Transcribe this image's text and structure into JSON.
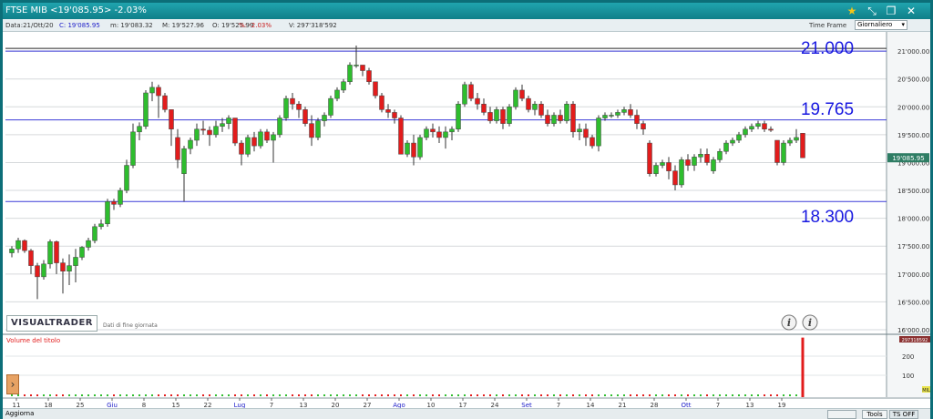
{
  "window": {
    "title": "FTSE MIB <19'085.95> -2.03%",
    "star_icon": "star-icon",
    "collapse_icon": "arrow-diagonal-icon",
    "restore_icon": "restore-icon",
    "close_icon": "close-icon"
  },
  "info": {
    "data": "Data:21/Ott/20",
    "close": "C: 19'085.95",
    "min": "m: 19'083.32",
    "max": "M: 19'527.96",
    "open": "O: 19'525.99",
    "pct": "%: -2.03%",
    "volume": "V: 297'318'592",
    "timeframe_label": "Time Frame",
    "timeframe_value": "Giornaliero"
  },
  "chart_data": {
    "type": "candlestick",
    "ylim": [
      16000,
      21100
    ],
    "y_ticks": [
      "21'000.00",
      "20'500.00",
      "20'000.00",
      "19'500.00",
      "19'000.00",
      "18'500.00",
      "18'000.00",
      "17'500.00",
      "17'000.00",
      "16'500.00",
      "16'000.00"
    ],
    "y_tick_values": [
      21000,
      20500,
      20000,
      19500,
      19000,
      18500,
      18000,
      17500,
      17000,
      16500,
      16000
    ],
    "x_labels": [
      "11",
      "18",
      "25",
      "Giu",
      "8",
      "15",
      "22",
      "Lug",
      "7",
      "13",
      "20",
      "27",
      "Ago",
      "10",
      "17",
      "24",
      "Set",
      "7",
      "14",
      "21",
      "28",
      "Ott",
      "7",
      "13",
      "19"
    ],
    "x_label_index": [
      0,
      5,
      10,
      15,
      20,
      25,
      30,
      35,
      40,
      45,
      50,
      55,
      60,
      65,
      70,
      75,
      80,
      85,
      90,
      95,
      100,
      105,
      110,
      115,
      120
    ],
    "x_label_is_month": [
      false,
      false,
      false,
      true,
      false,
      false,
      false,
      true,
      false,
      false,
      false,
      false,
      true,
      false,
      false,
      false,
      true,
      false,
      false,
      false,
      false,
      true,
      false,
      false,
      false
    ],
    "levels": [
      {
        "value": 21000,
        "label": "21.000"
      },
      {
        "value": 19765,
        "label": "19.765"
      },
      {
        "value": 18300,
        "label": "18.300"
      }
    ],
    "last_price_label": "19'085.95",
    "last_price": 19085.95,
    "candles": [
      [
        17380,
        17500,
        17300,
        17450
      ],
      [
        17450,
        17650,
        17380,
        17600
      ],
      [
        17600,
        17620,
        17380,
        17420
      ],
      [
        17420,
        17450,
        17000,
        17150
      ],
      [
        17150,
        17200,
        16550,
        16950
      ],
      [
        16950,
        17250,
        16900,
        17180
      ],
      [
        17180,
        17620,
        17100,
        17580
      ],
      [
        17580,
        17600,
        17000,
        17200
      ],
      [
        17200,
        17280,
        16650,
        17050
      ],
      [
        17050,
        17350,
        16800,
        17150
      ],
      [
        17150,
        17450,
        16850,
        17300
      ],
      [
        17300,
        17500,
        17250,
        17480
      ],
      [
        17480,
        17650,
        17420,
        17600
      ],
      [
        17600,
        17900,
        17550,
        17850
      ],
      [
        17850,
        17980,
        17800,
        17900
      ],
      [
        17900,
        18350,
        17850,
        18300
      ],
      [
        18300,
        18350,
        18150,
        18250
      ],
      [
        18250,
        18550,
        18200,
        18500
      ],
      [
        18500,
        19050,
        18450,
        18950
      ],
      [
        18950,
        19700,
        18900,
        19550
      ],
      [
        19550,
        19720,
        19400,
        19650
      ],
      [
        19650,
        20300,
        19600,
        20250
      ],
      [
        20250,
        20450,
        20100,
        20350
      ],
      [
        20350,
        20400,
        19800,
        20200
      ],
      [
        20200,
        20250,
        19900,
        19950
      ],
      [
        19950,
        19950,
        19300,
        19600
      ],
      [
        19450,
        19600,
        18900,
        19050
      ],
      [
        18800,
        19300,
        18300,
        19250
      ],
      [
        19250,
        19450,
        19150,
        19400
      ],
      [
        19400,
        19700,
        19300,
        19600
      ],
      [
        19600,
        19750,
        19500,
        19580
      ],
      [
        19580,
        19650,
        19300,
        19500
      ],
      [
        19500,
        19750,
        19450,
        19650
      ],
      [
        19650,
        19800,
        19550,
        19700
      ],
      [
        19700,
        19850,
        19600,
        19800
      ],
      [
        19800,
        19800,
        19300,
        19350
      ],
      [
        19350,
        19400,
        18950,
        19150
      ],
      [
        19150,
        19500,
        19100,
        19450
      ],
      [
        19450,
        19550,
        19200,
        19300
      ],
      [
        19300,
        19600,
        19250,
        19550
      ],
      [
        19550,
        19600,
        19350,
        19400
      ],
      [
        19400,
        19550,
        19000,
        19500
      ],
      [
        19500,
        19850,
        19450,
        19800
      ],
      [
        19800,
        20200,
        19750,
        20150
      ],
      [
        20150,
        20250,
        19950,
        20050
      ],
      [
        20050,
        20100,
        19800,
        19950
      ],
      [
        19950,
        20000,
        19650,
        19700
      ],
      [
        19700,
        19850,
        19300,
        19450
      ],
      [
        19450,
        19800,
        19400,
        19750
      ],
      [
        19750,
        19900,
        19650,
        19850
      ],
      [
        19850,
        20200,
        19800,
        20150
      ],
      [
        20150,
        20350,
        20100,
        20300
      ],
      [
        20300,
        20500,
        20250,
        20450
      ],
      [
        20450,
        20800,
        20400,
        20750
      ],
      [
        20750,
        21100,
        20700,
        20750
      ],
      [
        20750,
        20700,
        20550,
        20650
      ],
      [
        20650,
        20700,
        20400,
        20450
      ],
      [
        20450,
        20450,
        20150,
        20200
      ],
      [
        20200,
        20250,
        19900,
        19950
      ],
      [
        19950,
        20050,
        19800,
        19900
      ],
      [
        19900,
        19950,
        19700,
        19800
      ],
      [
        19800,
        19850,
        19150,
        19150
      ],
      [
        19150,
        19400,
        19100,
        19350
      ],
      [
        19350,
        19500,
        18950,
        19100
      ],
      [
        19100,
        19500,
        19050,
        19450
      ],
      [
        19450,
        19650,
        19400,
        19600
      ],
      [
        19600,
        19700,
        19450,
        19550
      ],
      [
        19550,
        19650,
        19350,
        19450
      ],
      [
        19450,
        19650,
        19250,
        19550
      ],
      [
        19550,
        19650,
        19400,
        19600
      ],
      [
        19600,
        20100,
        19550,
        20050
      ],
      [
        20050,
        20450,
        20000,
        20400
      ],
      [
        20400,
        20450,
        20100,
        20150
      ],
      [
        20150,
        20250,
        19950,
        20050
      ],
      [
        20050,
        20150,
        19850,
        19900
      ],
      [
        19900,
        20000,
        19700,
        19750
      ],
      [
        19750,
        20000,
        19700,
        19950
      ],
      [
        19950,
        20000,
        19600,
        19700
      ],
      [
        19700,
        20050,
        19650,
        20000
      ],
      [
        20000,
        20350,
        19950,
        20300
      ],
      [
        20300,
        20400,
        20100,
        20150
      ],
      [
        20150,
        20200,
        19900,
        19950
      ],
      [
        19950,
        20100,
        19850,
        20050
      ],
      [
        20050,
        20100,
        19800,
        19850
      ],
      [
        19850,
        19950,
        19650,
        19700
      ],
      [
        19700,
        19900,
        19650,
        19850
      ],
      [
        19850,
        19950,
        19700,
        19750
      ],
      [
        19750,
        20100,
        19700,
        20050
      ],
      [
        20050,
        20100,
        19450,
        19550
      ],
      [
        19550,
        19700,
        19400,
        19600
      ],
      [
        19600,
        19700,
        19300,
        19450
      ],
      [
        19450,
        19500,
        19250,
        19300
      ],
      [
        19300,
        19850,
        19200,
        19800
      ],
      [
        19800,
        19900,
        19750,
        19850
      ],
      [
        19850,
        19900,
        19800,
        19850
      ],
      [
        19850,
        19950,
        19800,
        19900
      ],
      [
        19900,
        20000,
        19850,
        19950
      ],
      [
        19950,
        20050,
        19800,
        19850
      ],
      [
        19850,
        19950,
        19600,
        19700
      ],
      [
        19700,
        19750,
        19500,
        19600
      ],
      [
        19350,
        19400,
        18750,
        18800
      ],
      [
        18800,
        19000,
        18750,
        18950
      ],
      [
        18950,
        19050,
        18900,
        19000
      ],
      [
        19000,
        19100,
        18700,
        18850
      ],
      [
        18850,
        18950,
        18500,
        18600
      ],
      [
        18600,
        19100,
        18550,
        19050
      ],
      [
        19050,
        19150,
        18850,
        18950
      ],
      [
        18950,
        19150,
        18850,
        19100
      ],
      [
        19100,
        19250,
        19000,
        19150
      ],
      [
        19150,
        19250,
        18950,
        19000
      ],
      [
        18850,
        19100,
        18800,
        19050
      ],
      [
        19050,
        19250,
        19000,
        19200
      ],
      [
        19200,
        19400,
        19150,
        19350
      ],
      [
        19350,
        19450,
        19300,
        19400
      ],
      [
        19400,
        19550,
        19350,
        19500
      ],
      [
        19500,
        19650,
        19450,
        19600
      ],
      [
        19600,
        19700,
        19550,
        19650
      ],
      [
        19650,
        19750,
        19600,
        19700
      ],
      [
        19700,
        19750,
        19550,
        19600
      ],
      [
        19600,
        19650,
        19550,
        19580
      ],
      [
        19400,
        19400,
        18950,
        19000
      ],
      [
        19000,
        19400,
        18950,
        19350
      ],
      [
        19350,
        19450,
        19300,
        19400
      ],
      [
        19400,
        19600,
        19350,
        19450
      ],
      [
        19525.99,
        19527.96,
        19083.32,
        19085.95
      ]
    ],
    "volume": {
      "label": "Volume del titolo",
      "ylim": [
        0,
        300
      ],
      "ticks": [
        200,
        100
      ],
      "last_value": 297,
      "marker_label": "MIL",
      "top_label": "297318592"
    },
    "colors": {
      "up": "#2ebd2e",
      "down": "#e21c1c",
      "level": "#3b3bd8",
      "level_text": "#1818e0",
      "volume": "#e21c1c"
    }
  },
  "overlay": {
    "logo": "VISUALTRADER",
    "logo_sub": "Dati di fine giornata",
    "info_icon_1": "info-icon",
    "info_icon_2": "info-icon"
  },
  "bottom": {
    "aggiorna": "Aggiorna",
    "tools": "Tools",
    "ts_off": "TS OFF",
    "scroll_arrow_icon": "chevron-right-icon"
  }
}
